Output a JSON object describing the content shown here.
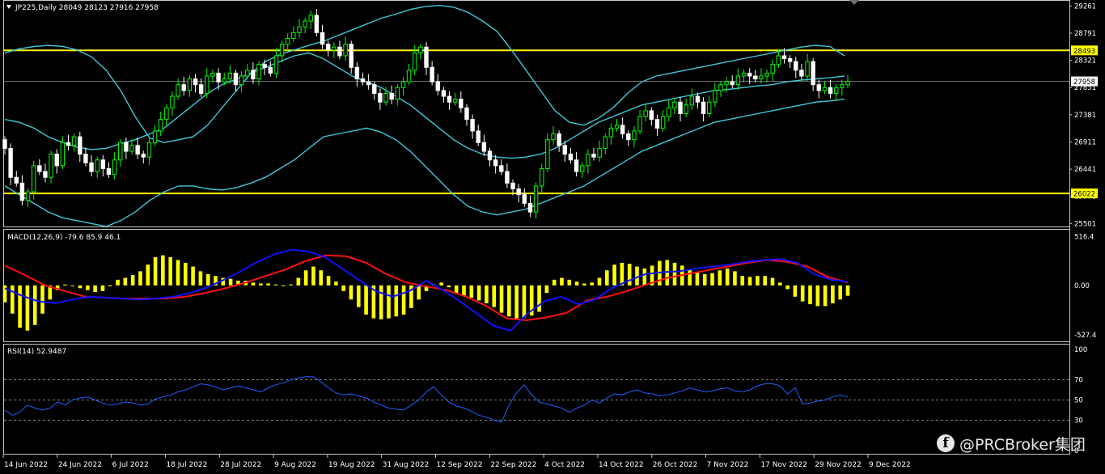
{
  "colors": {
    "background": "#000000",
    "frame": "#c8c8c8",
    "bull_candle": "#00ff00",
    "bear_candle": "#ffffff",
    "bollinger": "#40c8d8",
    "level_line": "#ffff00",
    "macd_histogram": "#ffff00",
    "macd_line": "#1010ff",
    "signal_line": "#ff1010",
    "rsi_line": "#2060ff",
    "label_bg_yellow": "#ffff00",
    "label_bg_white": "#ffffff",
    "text": "#ffffff"
  },
  "chart_data": [
    {
      "type": "candlestick",
      "title": "JP225,Daily  28049 28123 27916 27958",
      "yticks": [
        "29261",
        "28791",
        "28321",
        "27851",
        "27381",
        "26911",
        "26441",
        "25971",
        "25501"
      ],
      "ylim": [
        25450,
        29350
      ],
      "price_labels": [
        {
          "text": "28493",
          "value": 28493,
          "style": "yellow"
        },
        {
          "text": "27958",
          "value": 27958,
          "style": "white"
        },
        {
          "text": "26022",
          "value": 26022,
          "style": "yellow"
        }
      ],
      "horizontal_levels": [
        28493,
        26022
      ],
      "current_price": 27958,
      "x_dates": [
        "14 Jun 2022",
        "24 Jun 2022",
        "6 Jul 2022",
        "18 Jul 2022",
        "28 Jul 2022",
        "9 Aug 2022",
        "19 Aug 2022",
        "31 Aug 2022",
        "12 Sep 2022",
        "22 Sep 2022",
        "4 Oct 2022",
        "14 Oct 2022",
        "26 Oct 2022",
        "7 Nov 2022",
        "17 Nov 2022",
        "29 Nov 2022",
        "9 Dec 2022"
      ],
      "closes": [
        26800,
        26300,
        26200,
        25900,
        26050,
        26500,
        26400,
        26300,
        26700,
        26500,
        26900,
        26850,
        27000,
        26700,
        26550,
        26400,
        26600,
        26450,
        26350,
        26600,
        26900,
        26750,
        26850,
        26700,
        26650,
        26900,
        27100,
        27300,
        27500,
        27700,
        27900,
        27800,
        28000,
        27900,
        27750,
        28050,
        28100,
        27950,
        28000,
        28100,
        27900,
        28050,
        28150,
        28000,
        28250,
        28200,
        28100,
        28400,
        28600,
        28700,
        28800,
        28900,
        29000,
        29100,
        28800,
        28600,
        28500,
        28550,
        28400,
        28600,
        28200,
        28000,
        27950,
        27900,
        27750,
        27600,
        27750,
        27650,
        27850,
        27950,
        28150,
        28450,
        28550,
        28200,
        27950,
        27800,
        27700,
        27600,
        27650,
        27500,
        27300,
        27100,
        26900,
        26750,
        26600,
        26500,
        26400,
        26200,
        26100,
        26000,
        25850,
        25700,
        26150,
        26450,
        26950,
        27050,
        26850,
        26700,
        26600,
        26400,
        26500,
        26700,
        26650,
        26800,
        27000,
        27150,
        27200,
        27050,
        26950,
        27100,
        27350,
        27450,
        27300,
        27150,
        27350,
        27500,
        27600,
        27400,
        27550,
        27700,
        27600,
        27400,
        27600,
        27800,
        27900,
        27950,
        27900,
        28050,
        28100,
        28050,
        28000,
        28050,
        28100,
        28250,
        28400,
        28350,
        28300,
        28150,
        28050,
        28300,
        27900,
        27800,
        27850,
        27750,
        27850,
        27900,
        27958
      ],
      "bollinger": {
        "upper": [
          28450,
          28520,
          28560,
          28580,
          28560,
          28500,
          28380,
          28150,
          27800,
          27350,
          26980,
          26900,
          26950,
          27000,
          27200,
          27500,
          27800,
          28100,
          28300,
          28420,
          28500,
          28580,
          28650,
          28750,
          28850,
          28950,
          29050,
          29120,
          29200,
          29250,
          29270,
          29240,
          29150,
          29000,
          28820,
          28500,
          28150,
          27800,
          27450,
          27250,
          27200,
          27320,
          27500,
          27750,
          27950,
          28050,
          28100,
          28150,
          28200,
          28250,
          28300,
          28350,
          28400,
          28450,
          28500,
          28550,
          28580,
          28560,
          28400
        ],
        "middle": [
          27300,
          27250,
          27150,
          27000,
          26900,
          26820,
          26780,
          26800,
          26880,
          26950,
          27050,
          27150,
          27350,
          27550,
          27750,
          27900,
          28000,
          28100,
          28200,
          28300,
          28400,
          28450,
          28350,
          28200,
          28050,
          27950,
          27850,
          27700,
          27550,
          27350,
          27150,
          26950,
          26800,
          26700,
          26650,
          26630,
          26650,
          26700,
          26800,
          26950,
          27100,
          27250,
          27350,
          27450,
          27550,
          27600,
          27650,
          27700,
          27750,
          27800,
          27820,
          27850,
          27880,
          27900,
          27950,
          27980,
          28000,
          28020,
          28050
        ],
        "lower": [
          26150,
          26000,
          25850,
          25700,
          25600,
          25550,
          25500,
          25450,
          25550,
          25700,
          25900,
          26050,
          26150,
          26150,
          26100,
          26080,
          26120,
          26200,
          26300,
          26450,
          26600,
          26800,
          27000,
          27050,
          27100,
          27150,
          27080,
          26950,
          26750,
          26500,
          26250,
          26000,
          25800,
          25700,
          25650,
          25700,
          25750,
          25850,
          25950,
          26050,
          26150,
          26300,
          26450,
          26600,
          26750,
          26850,
          26950,
          27050,
          27150,
          27250,
          27300,
          27350,
          27400,
          27450,
          27500,
          27550,
          27600,
          27620,
          27650
        ]
      }
    },
    {
      "type": "bar",
      "title": "MACD(12,26,9) -79.6 85.9 46.1",
      "yticks": [
        "516.4",
        "0.00",
        "-527.4"
      ],
      "ylim": [
        -560,
        540
      ],
      "histogram": [
        -180,
        -300,
        -450,
        -480,
        -420,
        -300,
        -150,
        -50,
        10,
        0,
        -30,
        -50,
        -70,
        -60,
        -10,
        60,
        80,
        110,
        150,
        220,
        300,
        320,
        300,
        270,
        240,
        200,
        150,
        120,
        100,
        80,
        70,
        50,
        50,
        30,
        20,
        20,
        10,
        0,
        10,
        80,
        160,
        200,
        160,
        100,
        40,
        -60,
        -150,
        -230,
        -310,
        -350,
        -360,
        -350,
        -330,
        -310,
        -240,
        -150,
        -60,
        10,
        30,
        -20,
        -80,
        -110,
        -130,
        -160,
        -190,
        -230,
        -290,
        -330,
        -350,
        -340,
        -320,
        -280,
        -80,
        60,
        80,
        60,
        40,
        20,
        30,
        80,
        160,
        220,
        240,
        230,
        200,
        180,
        210,
        260,
        270,
        240,
        210,
        170,
        140,
        120,
        130,
        160,
        180,
        150,
        100,
        90,
        100,
        100,
        80,
        30,
        -40,
        -120,
        -170,
        -200,
        -220,
        -220,
        -190,
        -150,
        -110
      ],
      "macd": [
        -30,
        -110,
        -170,
        -190,
        -150,
        -120,
        -130,
        -140,
        -150,
        -140,
        -120,
        -80,
        -20,
        60,
        150,
        250,
        330,
        380,
        360,
        300,
        180,
        60,
        -60,
        -120,
        -60,
        50,
        -50,
        -170,
        -300,
        -430,
        -480,
        -300,
        -170,
        -120,
        -200,
        -150,
        -30,
        50,
        120,
        140,
        150,
        180,
        200,
        220,
        250,
        270,
        280,
        240,
        120,
        60,
        40
      ],
      "signal": [
        210,
        110,
        0,
        -60,
        -120,
        -130,
        -140,
        -140,
        -140,
        -120,
        -80,
        -30,
        30,
        100,
        170,
        260,
        320,
        310,
        240,
        120,
        30,
        -10,
        -50,
        -120,
        -220,
        -350,
        -370,
        -340,
        -290,
        -160,
        -120,
        -60,
        10,
        80,
        120,
        160,
        200,
        240,
        270,
        250,
        200,
        90,
        30
      ],
      "xlabel": "",
      "ylabel": ""
    },
    {
      "type": "line",
      "title": "RSI(14) 52.9487",
      "yticks": [
        "100",
        "70",
        "50",
        "30",
        "0"
      ],
      "ylim": [
        0,
        100
      ],
      "levels": [
        70,
        50,
        30
      ],
      "values": [
        40,
        35,
        38,
        45,
        42,
        40,
        42,
        48,
        45,
        50,
        52,
        53,
        50,
        47,
        45,
        46,
        48,
        47,
        45,
        46,
        51,
        53,
        55,
        58,
        60,
        63,
        66,
        65,
        63,
        60,
        62,
        64,
        62,
        60,
        58,
        62,
        65,
        67,
        70,
        72,
        73,
        73,
        68,
        62,
        57,
        55,
        56,
        54,
        52,
        48,
        45,
        42,
        41,
        40,
        45,
        50,
        58,
        63,
        55,
        48,
        44,
        42,
        39,
        35,
        33,
        30,
        28,
        45,
        57,
        65,
        55,
        48,
        46,
        44,
        42,
        38,
        42,
        45,
        50,
        47,
        52,
        56,
        55,
        58,
        60,
        57,
        56,
        54,
        55,
        57,
        59,
        62,
        60,
        58,
        59,
        61,
        62,
        59,
        58,
        60,
        64,
        66,
        66,
        64,
        56,
        62,
        46,
        47,
        49,
        50,
        53,
        55,
        53
      ],
      "xlabel": "",
      "ylabel": ""
    }
  ],
  "watermark": {
    "icon": "facebook-icon",
    "text": "@PRCBroker集团"
  }
}
